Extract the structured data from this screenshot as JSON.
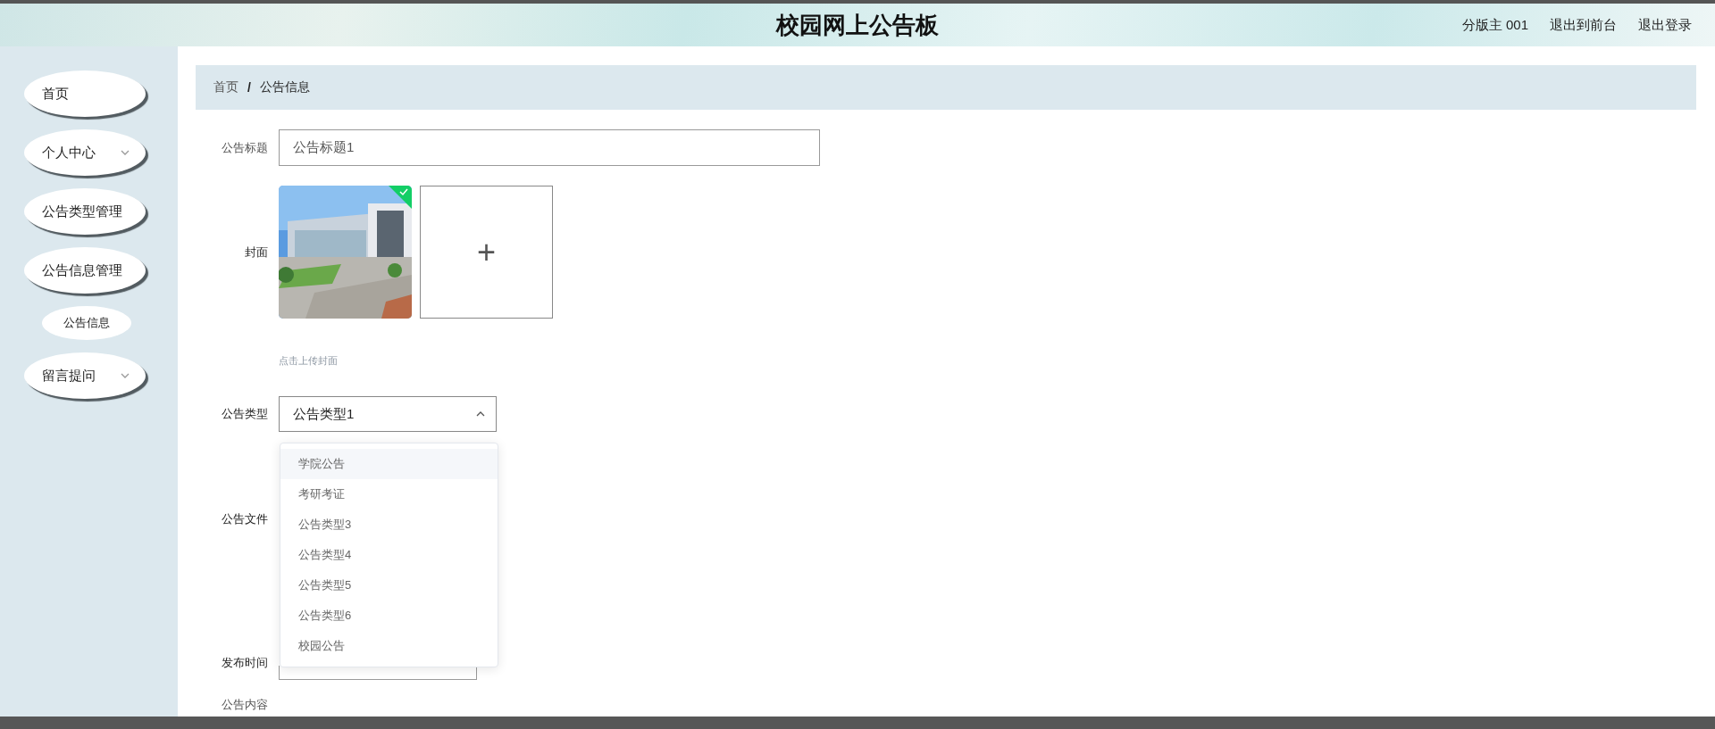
{
  "header": {
    "title": "校园网上公告板",
    "user": "分版主 001",
    "links": [
      "退出到前台",
      "退出登录"
    ]
  },
  "sidebar": {
    "items": [
      {
        "label": "首页",
        "kind": "link"
      },
      {
        "label": "个人中心",
        "kind": "submenu"
      },
      {
        "label": "公告类型管理",
        "kind": "link"
      },
      {
        "label": "公告信息管理",
        "kind": "link",
        "children": [
          {
            "label": "公告信息"
          }
        ]
      },
      {
        "label": "留言提问",
        "kind": "submenu"
      }
    ]
  },
  "breadcrumb": [
    "首页",
    "公告信息"
  ],
  "breadcrumb_separator": "/",
  "form": {
    "title": {
      "label": "公告标题",
      "value": "公告标题1"
    },
    "cover": {
      "label": "封面",
      "hint": "点击上传封面",
      "plus": "+"
    },
    "type": {
      "label": "公告类型",
      "value": "公告类型1",
      "expanded": true,
      "options": [
        {
          "label": "学院公告",
          "selected": true
        },
        {
          "label": "考研考证",
          "selected": false
        },
        {
          "label": "公告类型3",
          "selected": false
        },
        {
          "label": "公告类型4",
          "selected": false
        },
        {
          "label": "公告类型5",
          "selected": false
        },
        {
          "label": "公告类型6",
          "selected": false
        },
        {
          "label": "校园公告",
          "selected": false
        }
      ]
    },
    "file": {
      "label": "公告文件"
    },
    "time": {
      "label": "发布时间"
    },
    "content": {
      "label": "公告内容"
    }
  }
}
